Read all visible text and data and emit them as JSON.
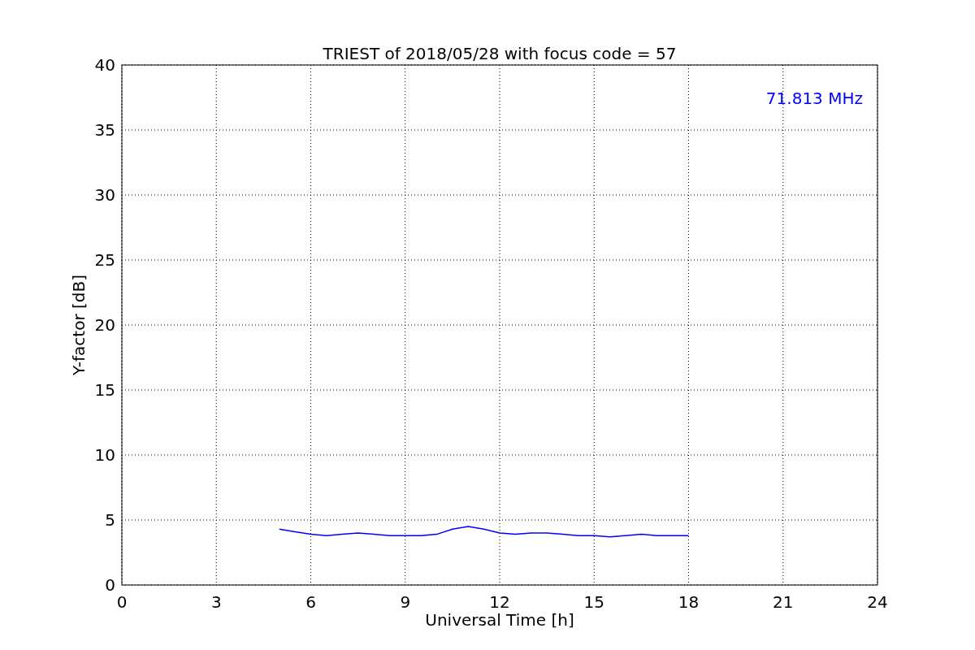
{
  "chart_data": {
    "type": "line",
    "title": "TRIEST of 2018/05/28 with focus code = 57",
    "xlabel": "Universal Time [h]",
    "ylabel": "Y-factor [dB]",
    "x": [
      5.0,
      5.5,
      6.0,
      6.5,
      7.0,
      7.5,
      8.0,
      8.5,
      9.0,
      9.5,
      10.0,
      10.5,
      11.0,
      11.5,
      12.0,
      12.5,
      13.0,
      13.5,
      14.0,
      14.5,
      15.0,
      15.5,
      16.0,
      16.5,
      17.0,
      17.5,
      18.0
    ],
    "series": [
      {
        "name": "71.813 MHz",
        "color": "#0000ff",
        "values": [
          4.3,
          4.1,
          3.9,
          3.8,
          3.9,
          4.0,
          3.9,
          3.8,
          3.8,
          3.8,
          3.9,
          4.3,
          4.5,
          4.3,
          4.0,
          3.9,
          4.0,
          4.0,
          3.9,
          3.8,
          3.8,
          3.7,
          3.8,
          3.9,
          3.8,
          3.8,
          3.8
        ]
      }
    ],
    "xlim": [
      0,
      24
    ],
    "ylim": [
      0,
      40
    ],
    "xticks": [
      0,
      3,
      6,
      9,
      12,
      15,
      18,
      21,
      24
    ],
    "yticks": [
      0,
      5,
      10,
      15,
      20,
      25,
      30,
      35,
      40
    ],
    "grid": true
  }
}
